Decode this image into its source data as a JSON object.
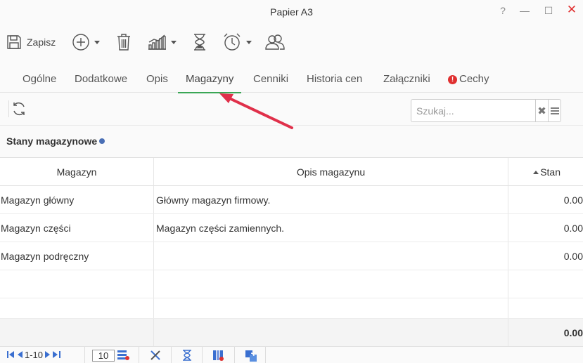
{
  "window": {
    "title": "Papier A3",
    "help": "?",
    "minimize": "—",
    "maximize": "☐",
    "close": "✕"
  },
  "toolbar": {
    "save_label": "Zapisz"
  },
  "tabs": [
    {
      "label": "Ogólne"
    },
    {
      "label": "Dodatkowe"
    },
    {
      "label": "Opis"
    },
    {
      "label": "Magazyny"
    },
    {
      "label": "Cenniki"
    },
    {
      "label": "Historia cen"
    },
    {
      "label": "Załączniki"
    },
    {
      "label": "Cechy"
    }
  ],
  "tab_warning_mark": "!",
  "active_tab": "Magazyny",
  "search": {
    "placeholder": "Szukaj...",
    "clear": "✖"
  },
  "section_title": "Stany magazynowe",
  "grid": {
    "headers": [
      "Magazyn",
      "Opis magazynu",
      "Stan"
    ],
    "rows": [
      {
        "magazyn": "Magazyn główny",
        "opis": "Główny magazyn firmowy.",
        "stan": "0.00"
      },
      {
        "magazyn": "Magazyn części",
        "opis": "Magazyn części zamiennych.",
        "stan": "0.00"
      },
      {
        "magazyn": "Magazyn podręczny",
        "opis": "",
        "stan": "0.00"
      }
    ],
    "total": "0.00"
  },
  "pager": {
    "range": "1-10",
    "page_size": "10"
  },
  "colors": {
    "active_tab_underline": "#3aa655",
    "close_button": "#e03030",
    "annotation_arrow": "#e0304a"
  }
}
